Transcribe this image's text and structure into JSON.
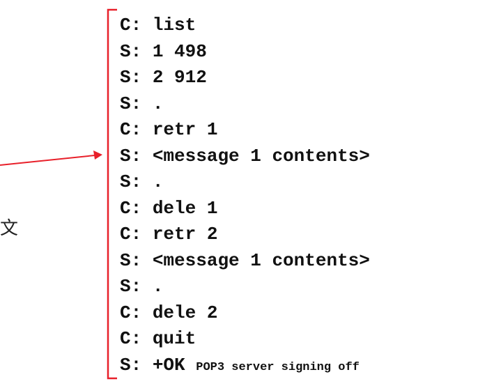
{
  "colors": {
    "bracket": "#e8202a",
    "arrow": "#e8202a",
    "text": "#111111"
  },
  "side_text": "文",
  "dialog": [
    {
      "speaker": "C:",
      "text": "list"
    },
    {
      "speaker": "S:",
      "text": "1 498"
    },
    {
      "speaker": "S:",
      "text": "2 912"
    },
    {
      "speaker": "S:",
      "text": "."
    },
    {
      "speaker": "C:",
      "text": "retr 1"
    },
    {
      "speaker": "S:",
      "text": "<message 1 contents>"
    },
    {
      "speaker": "S:",
      "text": "."
    },
    {
      "speaker": "C:",
      "text": "dele 1"
    },
    {
      "speaker": "C:",
      "text": "retr 2"
    },
    {
      "speaker": "S:",
      "text": "<message 1 contents>"
    },
    {
      "speaker": "S:",
      "text": "."
    },
    {
      "speaker": "C:",
      "text": "dele 2"
    },
    {
      "speaker": "C:",
      "text": "quit"
    },
    {
      "speaker": "S:",
      "text": "+OK",
      "small_text": "POP3 server signing off"
    }
  ]
}
